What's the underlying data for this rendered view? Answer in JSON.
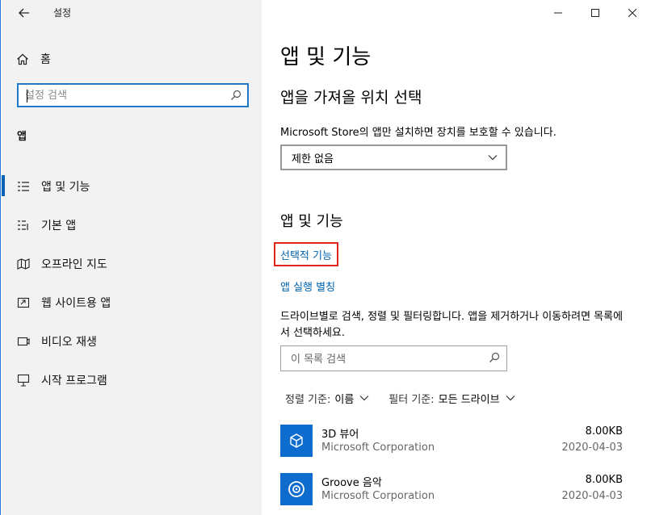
{
  "window": {
    "title": "설정",
    "controls": {
      "minimize_icon": "minimize-icon",
      "maximize_icon": "maximize-icon",
      "close_icon": "close-icon"
    }
  },
  "sidebar": {
    "back_icon": "arrow-left-icon",
    "home_label": "홈",
    "search_placeholder": "설정 검색",
    "section_label": "앱",
    "items": [
      {
        "label": "앱 및 기능",
        "icon": "apps-features-icon",
        "selected": true
      },
      {
        "label": "기본 앱",
        "icon": "default-apps-icon",
        "selected": false
      },
      {
        "label": "오프라인 지도",
        "icon": "offline-maps-icon",
        "selected": false
      },
      {
        "label": "웹 사이트용 앱",
        "icon": "apps-for-websites-icon",
        "selected": false
      },
      {
        "label": "비디오 재생",
        "icon": "video-playback-icon",
        "selected": false
      },
      {
        "label": "시작 프로그램",
        "icon": "startup-icon",
        "selected": false
      }
    ]
  },
  "main": {
    "page_title": "앱 및 기능",
    "choose_title": "앱을 가져올 위치 선택",
    "choose_desc": "Microsoft Store의 앱만 설치하면 장치를 보호할 수 있습니다.",
    "choose_value": "제한 없음",
    "apps_title": "앱 및 기능",
    "optional_features_link": "선택적 기능",
    "app_alias_link": "앱 실행 별칭",
    "list_desc": "드라이브별로 검색, 정렬 및 필터링합니다. 앱을 제거하거나 이동하려면 목록에서 선택하세요.",
    "list_search_placeholder": "이 목록 검색",
    "sort_label": "정렬 기준:",
    "sort_value": "이름",
    "filter_label": "필터 기준:",
    "filter_value": "모든 드라이브",
    "apps": [
      {
        "name": "3D 뷰어",
        "publisher": "Microsoft Corporation",
        "size": "8.00KB",
        "date": "2020-04-03",
        "icon": "cube-icon"
      },
      {
        "name": "Groove 음악",
        "publisher": "Microsoft Corporation",
        "size": "8.00KB",
        "date": "2020-04-03",
        "icon": "music-disc-icon"
      }
    ]
  },
  "colors": {
    "accent": "#0063b1",
    "app_tile": "#0f6ccf",
    "highlight_border": "#e0241b",
    "sidebar_bg": "#f2f2f2"
  }
}
